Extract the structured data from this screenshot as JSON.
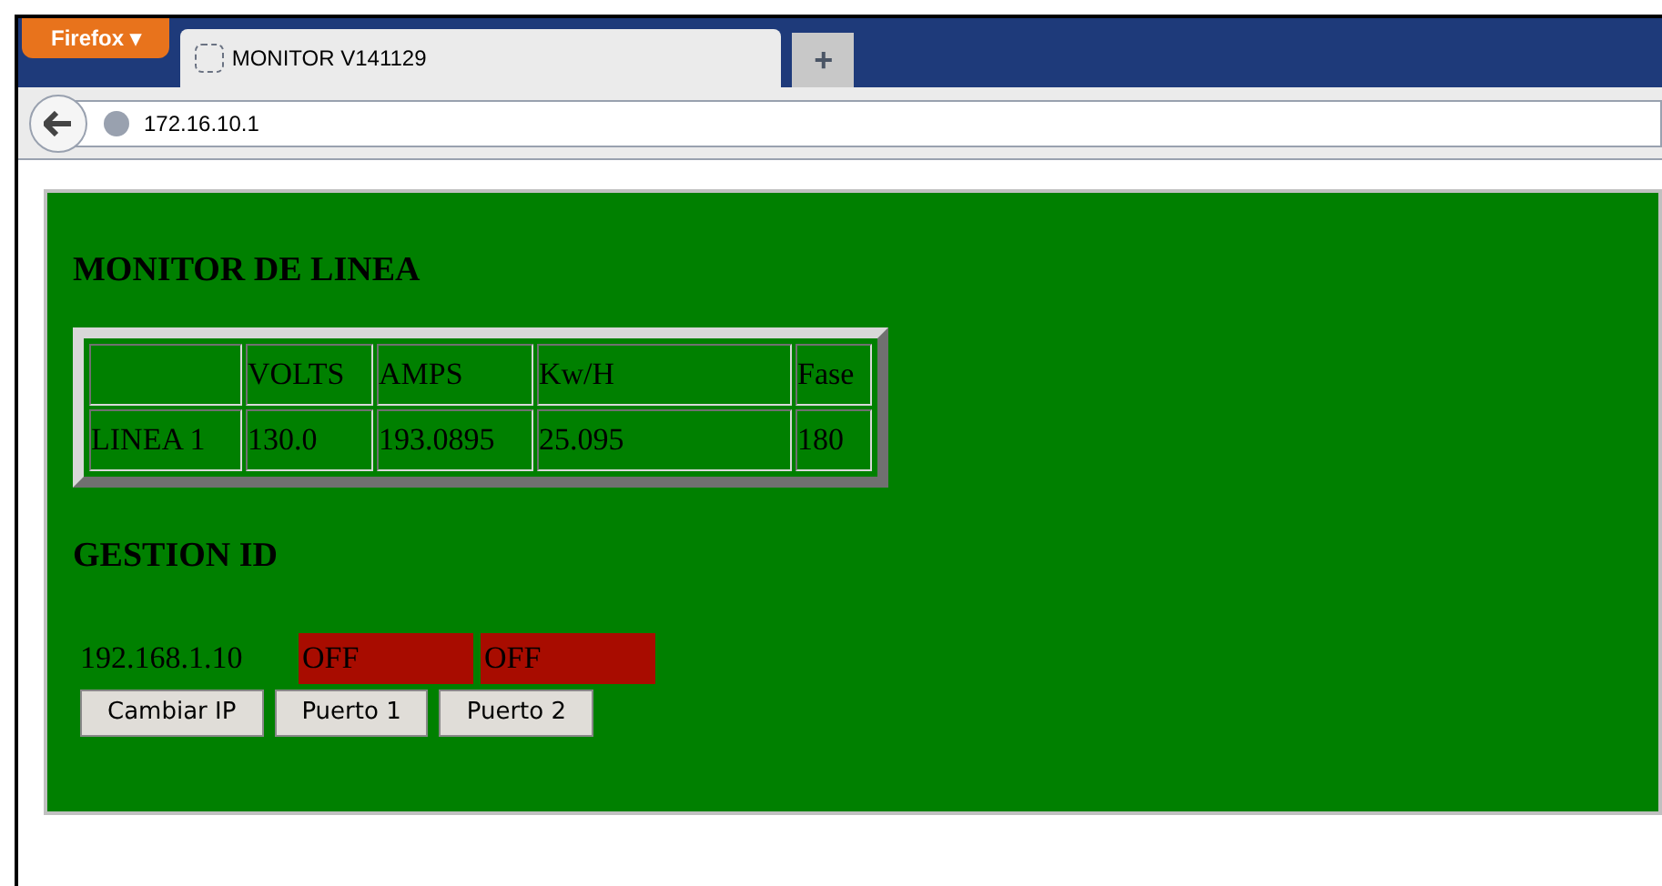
{
  "browser": {
    "menu_button": "Firefox ▾",
    "tab_title": "MONITOR V141129",
    "new_tab": "+",
    "url": "172.16.10.1"
  },
  "page": {
    "title": "MONITOR DE LINEA",
    "table": {
      "columns": [
        "",
        "VOLTS",
        "AMPS",
        "Kw/H",
        "Fase"
      ],
      "rows": [
        [
          "LINEA 1",
          "130.0",
          "193.0895",
          "25.095",
          "180"
        ]
      ]
    },
    "section": "GESTION ID",
    "ip": "192.168.1.10",
    "ports": [
      {
        "label": "OFF",
        "on": false
      },
      {
        "label": "OFF",
        "on": false
      }
    ],
    "buttons": [
      "Cambiar IP",
      "Puerto 1",
      "Puerto 2"
    ]
  }
}
